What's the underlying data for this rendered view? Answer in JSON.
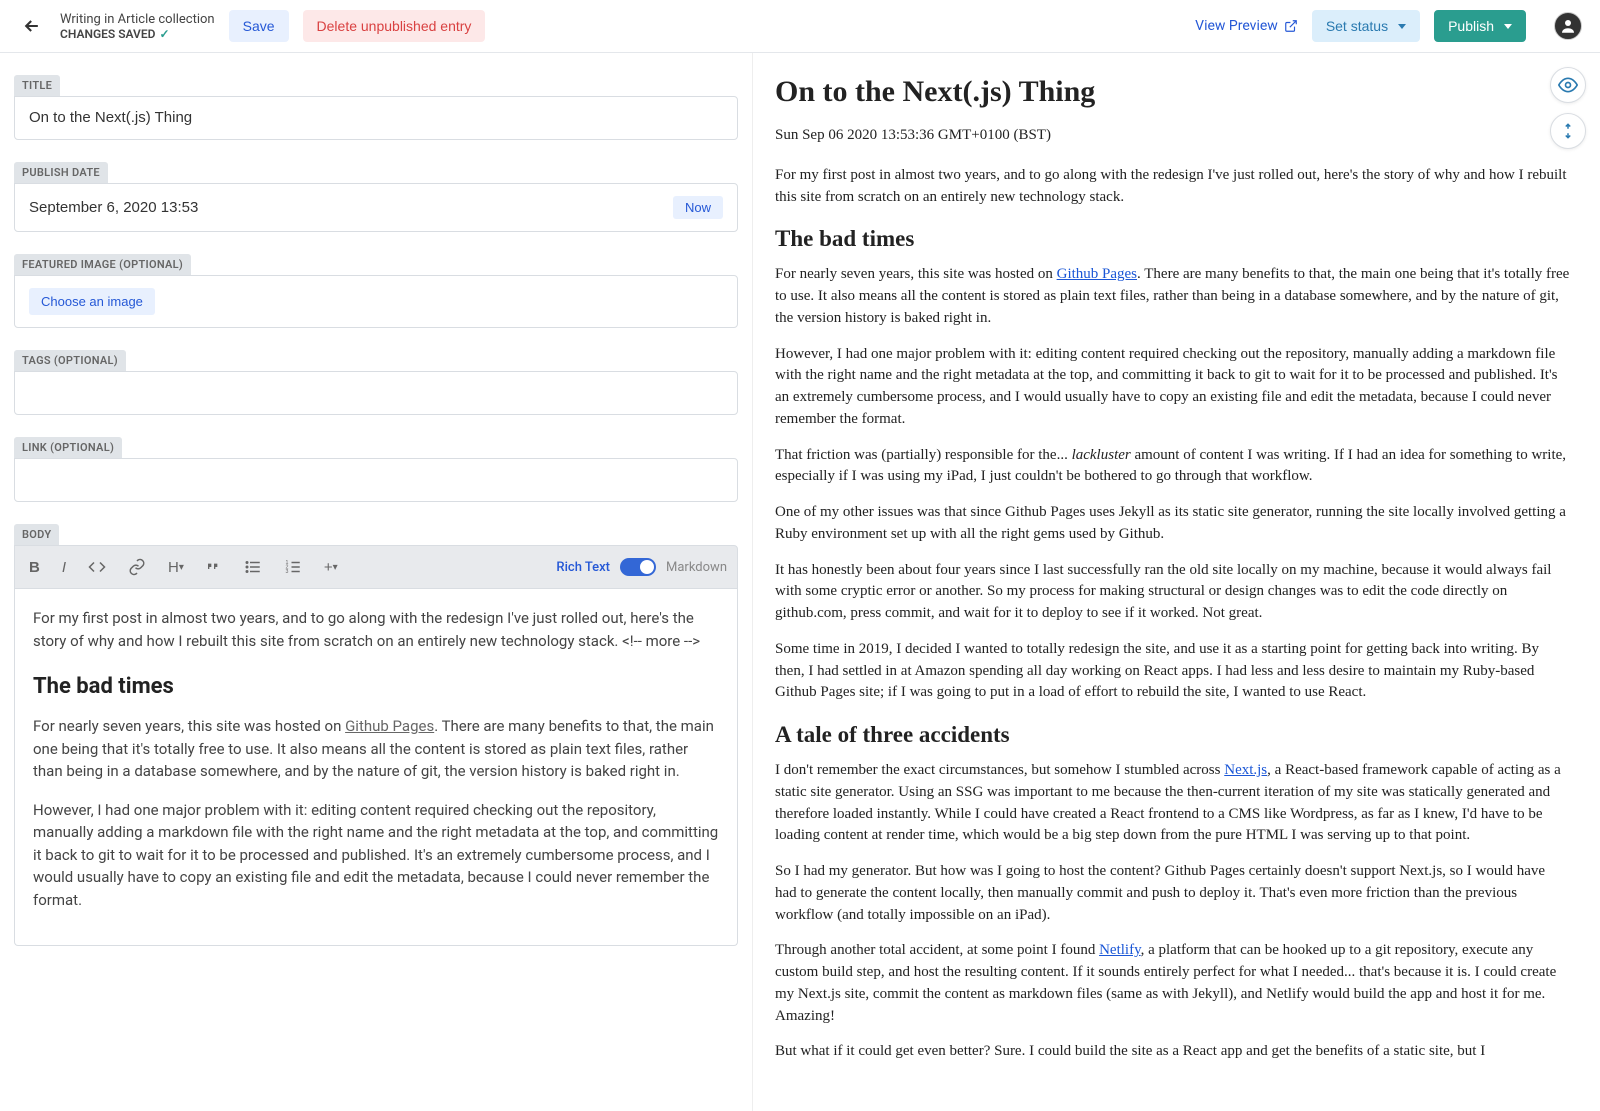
{
  "header": {
    "breadcrumb": "Writing in Article collection",
    "status_text": "CHANGES SAVED",
    "save_label": "Save",
    "delete_label": "Delete unpublished entry",
    "view_preview_label": "View Preview",
    "set_status_label": "Set status",
    "publish_label": "Publish"
  },
  "fields": {
    "title": {
      "label": "TITLE",
      "value": "On to the Next(.js) Thing"
    },
    "publish_date": {
      "label": "PUBLISH DATE",
      "value": "September 6, 2020 13:53",
      "now_label": "Now"
    },
    "featured_image": {
      "label": "FEATURED IMAGE (OPTIONAL)",
      "choose_label": "Choose an image"
    },
    "tags": {
      "label": "TAGS (OPTIONAL)"
    },
    "link": {
      "label": "LINK (OPTIONAL)"
    },
    "body": {
      "label": "BODY",
      "rich_text": "Rich Text",
      "markdown": "Markdown"
    }
  },
  "editor_body": {
    "p1": "For my first post in almost two years, and to go along with the redesign I've just rolled out, here's the story of why and how I rebuilt this site from scratch on an entirely new technology stack. <!-- more -->",
    "h1": "The bad times",
    "p2a": "For nearly seven years, this site was hosted on ",
    "p2link": "Github Pages",
    "p2b": ". There are many benefits to that, the main one being that it's totally free to use. It also means all the content is stored as plain text files, rather than being in a database somewhere, and by the nature of git, the version history is baked right in.",
    "p3": "However, I had one major problem with it: editing content required checking out the repository, manually adding a markdown file with the right name and the right metadata at the top, and committing it back to git to wait for it to be processed and published. It's an extremely cumbersome process, and I would usually have to copy an existing file and edit the metadata, because I could never remember the format."
  },
  "preview": {
    "title": "On to the Next(.js) Thing",
    "date": "Sun Sep 06 2020 13:53:36 GMT+0100 (BST)",
    "p1": "For my first post in almost two years, and to go along with the redesign I've just rolled out, here's the story of why and how I rebuilt this site from scratch on an entirely new technology stack.",
    "h2_1": "The bad times",
    "p2a": "For nearly seven years, this site was hosted on ",
    "p2link": "Github Pages",
    "p2b": ". There are many benefits to that, the main one being that it's totally free to use. It also means all the content is stored as plain text files, rather than being in a database somewhere, and by the nature of git, the version history is baked right in.",
    "p3": "However, I had one major problem with it: editing content required checking out the repository, manually adding a markdown file with the right name and the right metadata at the top, and committing it back to git to wait for it to be processed and published. It's an extremely cumbersome process, and I would usually have to copy an existing file and edit the metadata, because I could never remember the format.",
    "p4a": "That friction was (partially) responsible for the... ",
    "p4em": "lackluster",
    "p4b": " amount of content I was writing. If I had an idea for something to write, especially if I was using my iPad, I just couldn't be bothered to go through that workflow.",
    "p5": "One of my other issues was that since Github Pages uses Jekyll as its static site generator, running the site locally involved getting a Ruby environment set up with all the right gems used by Github.",
    "p6": "It has honestly been about four years since I last successfully ran the old site locally on my machine, because it would always fail with some cryptic error or another. So my process for making structural or design changes was to edit the code directly on github.com, press commit, and wait for it to deploy to see if it worked. Not great.",
    "p7": "Some time in 2019, I decided I wanted to totally redesign the site, and use it as a starting point for getting back into writing. By then, I had settled in at Amazon spending all day working on React apps. I had less and less desire to maintain my Ruby-based Github Pages site; if I was going to put in a load of effort to rebuild the site, I wanted to use React.",
    "h2_2": "A tale of three accidents",
    "p8a": "I don't remember the exact circumstances, but somehow I stumbled across ",
    "p8link": "Next.js",
    "p8b": ", a React-based framework capable of acting as a static site generator. Using an SSG was important to me because the then-current iteration of my site was statically generated and therefore loaded instantly. While I could have created a React frontend to a CMS like Wordpress, as far as I knew, I'd have to be loading content at render time, which would be a big step down from the pure HTML I was serving up to that point.",
    "p9": "So I had my generator. But how was I going to host the content? Github Pages certainly doesn't support Next.js, so I would have had to generate the content locally, then manually commit and push to deploy it. That's even more friction than the previous workflow (and totally impossible on an iPad).",
    "p10a": "Through another total accident, at some point I found ",
    "p10link": "Netlify",
    "p10b": ", a platform that can be hooked up to a git repository, execute any custom build step, and host the resulting content. If it sounds entirely perfect for what I needed... that's because it is. I could create my Next.js site, commit the content as markdown files (same as with Jekyll), and Netlify would build the app and host it for me. Amazing!",
    "p11": "But what if it could get even better? Sure. I could build the site as a React app and get the benefits of a static site, but I"
  }
}
